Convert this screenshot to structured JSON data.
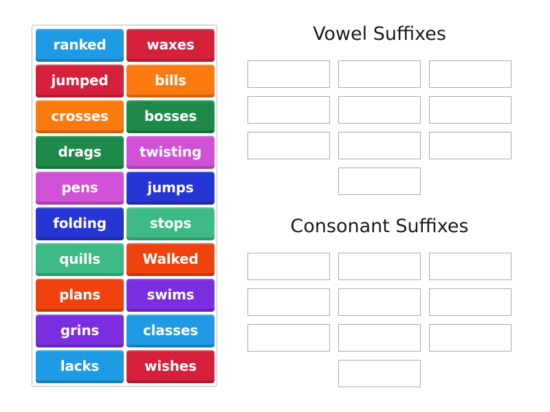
{
  "tiles": [
    {
      "label": "ranked",
      "color": "#1f9be6"
    },
    {
      "label": "waxes",
      "color": "#d4203a"
    },
    {
      "label": "jumped",
      "color": "#d4203a"
    },
    {
      "label": "bills",
      "color": "#fb7a10"
    },
    {
      "label": "crosses",
      "color": "#fb7a10"
    },
    {
      "label": "bosses",
      "color": "#1e8a4a"
    },
    {
      "label": "drags",
      "color": "#1e8a4a"
    },
    {
      "label": "twisting",
      "color": "#d050d6"
    },
    {
      "label": "pens",
      "color": "#d050d6"
    },
    {
      "label": "jumps",
      "color": "#2536d4"
    },
    {
      "label": "folding",
      "color": "#2536d4"
    },
    {
      "label": "stops",
      "color": "#3dba85"
    },
    {
      "label": "quills",
      "color": "#3dba85"
    },
    {
      "label": "Walked",
      "color": "#f0420e"
    },
    {
      "label": "plans",
      "color": "#f0420e"
    },
    {
      "label": "swims",
      "color": "#7b2ee0"
    },
    {
      "label": "grins",
      "color": "#7b2ee0"
    },
    {
      "label": "classes",
      "color": "#1f9be6"
    },
    {
      "label": "lacks",
      "color": "#1f9be6"
    },
    {
      "label": "wishes",
      "color": "#d4203a"
    }
  ],
  "groups": [
    {
      "title": "Vowel Suffixes",
      "slot_count": 10
    },
    {
      "title": "Consonant Suffixes",
      "slot_count": 10
    }
  ]
}
